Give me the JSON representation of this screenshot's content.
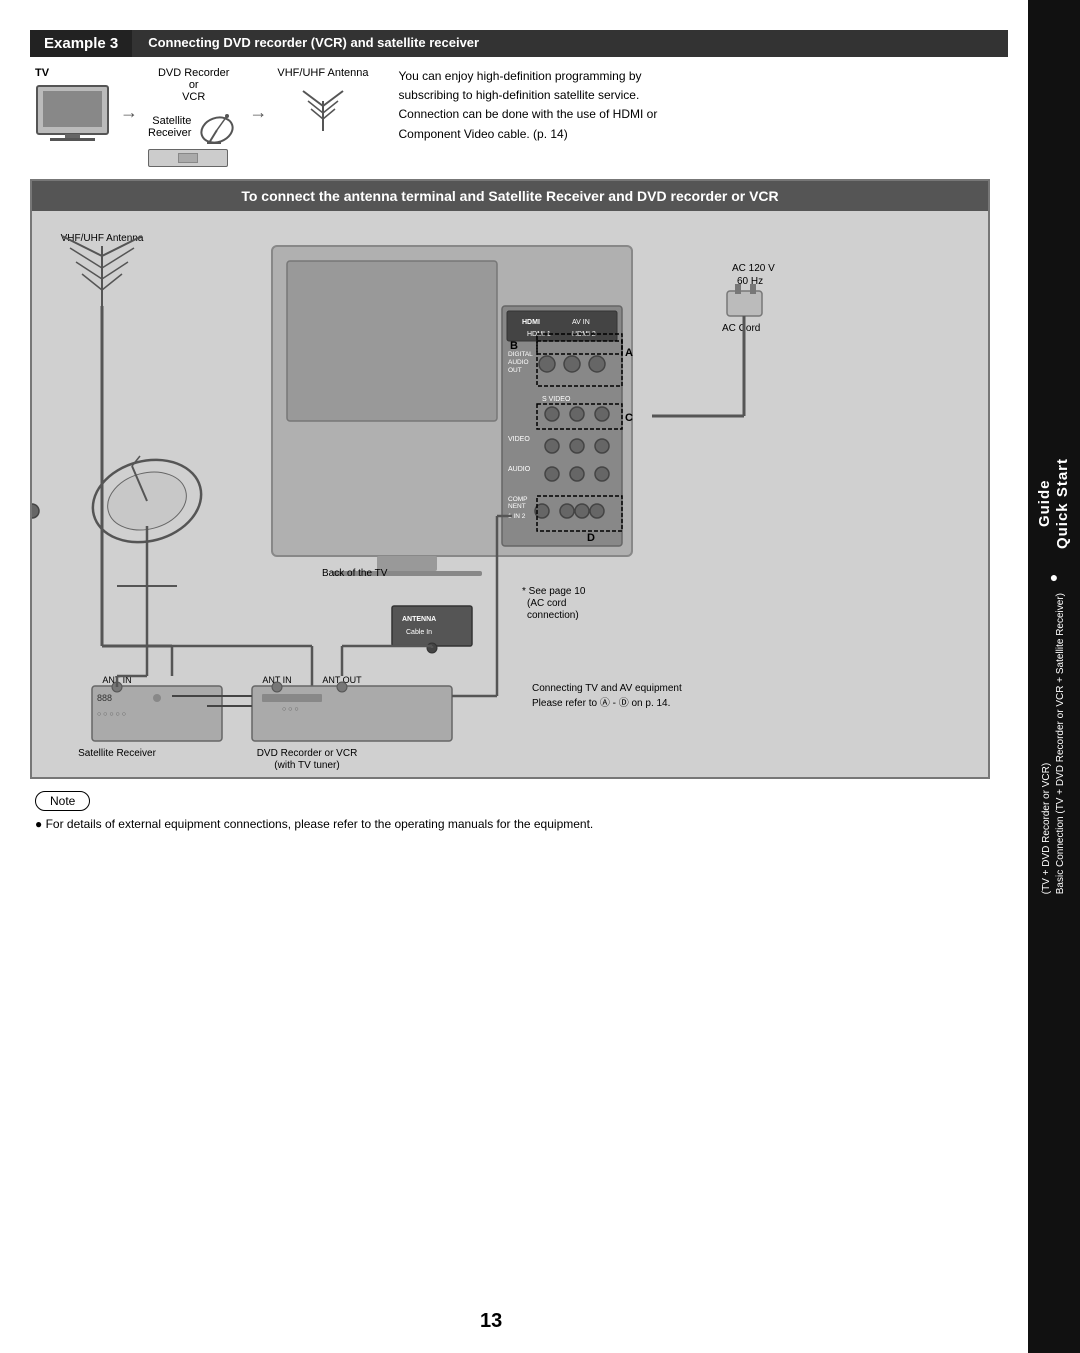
{
  "page": {
    "number": "13",
    "background": "#ffffff"
  },
  "sidebar": {
    "background": "#111111",
    "title_line1": "Quick Start",
    "title_line2": "Guide",
    "bullet": "●",
    "text_line1": "Basic Connection (TV + DVD Recorder or VCR + Satellite Receiver)",
    "text_line2": "(TV + DVD Recorder or VCR)"
  },
  "example3": {
    "badge": "Example 3",
    "title": "Connecting DVD recorder (VCR) and satellite receiver",
    "description": "You can enjoy high-definition programming by subscribing to high-definition satellite service. Connection can be done with the use of HDMI or Component Video cable. (p. 14)",
    "diagram_labels": {
      "tv": "TV",
      "dvd_recorder": "DVD Recorder",
      "or": "or",
      "vcr": "VCR",
      "satellite_receiver": "Satellite\nReceiver",
      "vhf_uhf_antenna": "VHF/UHF Antenna"
    }
  },
  "main_diagram": {
    "title": "To connect the antenna terminal and Satellite Receiver and DVD recorder or VCR",
    "labels": {
      "vhf_uhf_antenna": "VHF/UHF Antenna",
      "back_of_tv": "Back of the TV",
      "see_page": "* See page 10",
      "ac_cord_connection": "(AC cord\nconnection)",
      "ac_120v": "AC 120 V",
      "ac_hz": "60 Hz",
      "ac_cord": "AC Cord",
      "hdmi_label": "HDMI",
      "av_in": "AV IN",
      "hdmi1": "HDMI 1",
      "hdmi2": "HDMI 2",
      "digital_audio_out": "DIGITAL\nAUDIO\nOUT",
      "s_video": "S VIDEO",
      "video": "VIDEO",
      "antenna": "ANTENNA",
      "cable_in": "Cable In",
      "audio": "AUDIO",
      "component": "COMP\nNENT",
      "in": "IN",
      "marker_a": "A",
      "marker_b": "B",
      "marker_c": "C",
      "marker_d": "D",
      "ant_in_left": "ANT IN",
      "ant_in_right": "ANT IN",
      "ant_out": "ANT OUT",
      "satellite_receiver": "Satellite Receiver",
      "dvd_recorder_vcr": "DVD Recorder or VCR\n(with TV tuner)",
      "connecting_text": "Connecting TV and AV equipment",
      "please_refer": "Please refer to Ⓐ - Ⓓ on p. 14."
    }
  },
  "note": {
    "badge": "Note",
    "text": "For details of external equipment connections, please refer to the operating manuals for the equipment."
  }
}
